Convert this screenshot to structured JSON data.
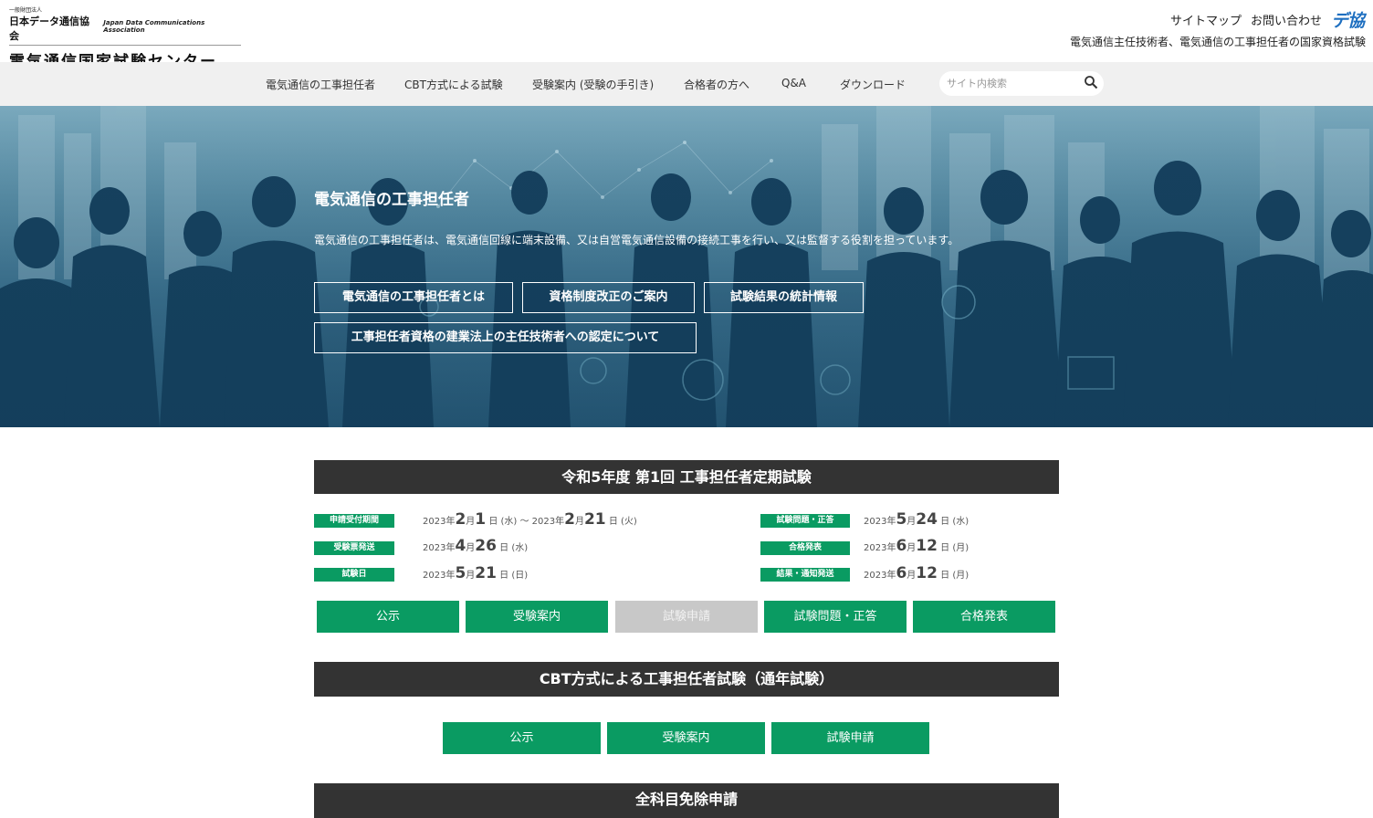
{
  "header": {
    "logo_small": "一般財団法人",
    "org_name": "日本データ通信協会",
    "org_name_en": "Japan Data Communications Association",
    "center_name": "電気通信国家試験センター",
    "sitemap": "サイトマップ",
    "contact": "お問い合わせ",
    "dekyo": "デ協",
    "tagline": "電気通信主任技術者、電気通信の工事担任者の国家資格試験"
  },
  "nav": {
    "items": [
      "電気通信の工事担任者",
      "CBT方式による試験",
      "受験案内 (受験の手引き)",
      "合格者の方へ",
      "Q&A",
      "ダウンロード"
    ],
    "search_placeholder": "サイト内検索"
  },
  "hero": {
    "title": "電気通信の工事担任者",
    "description": "電気通信の工事担任者は、電気通信回線に端末設備、又は自営電気通信設備の接続工事を行い、又は監督する役割を担っています。",
    "buttons": [
      "電気通信の工事担任者とは",
      "資格制度改正のご案内",
      "試験結果の統計情報",
      "工事担任者資格の建業法上の主任技術者への認定について"
    ]
  },
  "regular_exam": {
    "title": "令和5年度 第1回 工事担任者定期試験",
    "schedule": [
      {
        "label": "申請受付期間",
        "pre": "2023年",
        "m1": "2",
        "mu": "月",
        "d1": "1",
        "tail": "日 (水) ～ 2023年",
        "m2": "2",
        "mu2": "月",
        "d2": "21",
        "tail2": "日 (火)"
      },
      {
        "label": "受験票発送",
        "pre": "2023年",
        "m1": "4",
        "mu": "月",
        "d1": "26",
        "tail": "日 (水)"
      },
      {
        "label": "試験日",
        "pre": "2023年",
        "m1": "5",
        "mu": "月",
        "d1": "21",
        "tail": "日 (日)"
      },
      {
        "label": "試験問題・正答",
        "pre": "2023年",
        "m1": "5",
        "mu": "月",
        "d1": "24",
        "tail": "日 (水)"
      },
      {
        "label": "合格発表",
        "pre": "2023年",
        "m1": "6",
        "mu": "月",
        "d1": "12",
        "tail": "日 (月)"
      },
      {
        "label": "結果・通知発送",
        "pre": "2023年",
        "m1": "6",
        "mu": "月",
        "d1": "12",
        "tail": "日 (月)"
      }
    ],
    "buttons": [
      "公示",
      "受験案内",
      "試験申請",
      "試験問題・正答",
      "合格発表"
    ]
  },
  "cbt_exam": {
    "title": "CBT方式による工事担任者試験（通年試験）",
    "buttons": [
      "公示",
      "受験案内",
      "試験申請"
    ]
  },
  "exemption": {
    "title": "全科目免除申請"
  }
}
